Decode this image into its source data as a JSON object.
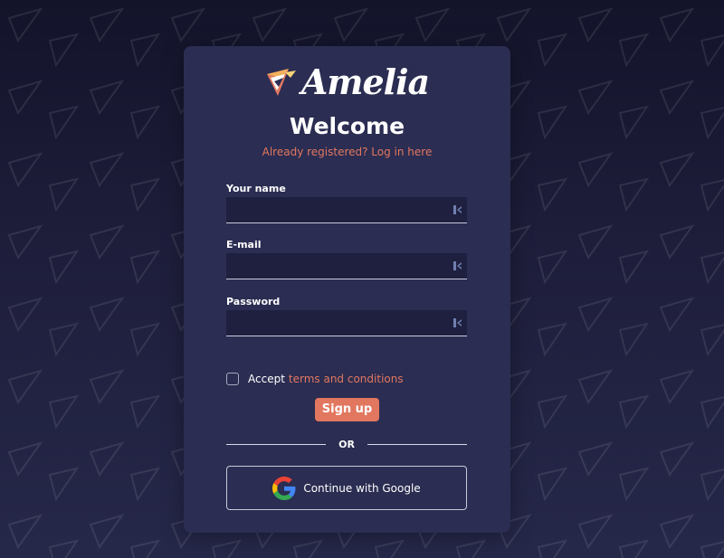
{
  "logo": {
    "text": "Amelia"
  },
  "welcome": {
    "title": "Welcome",
    "login_prompt": "Already registered? Log in here"
  },
  "fields": [
    {
      "label": "Your name",
      "value": "",
      "placeholder": ""
    },
    {
      "label": "E-mail",
      "value": "",
      "placeholder": ""
    },
    {
      "label": "Password",
      "value": "",
      "placeholder": ""
    }
  ],
  "terms": {
    "accept_text": "Accept",
    "link_text": "terms and conditions",
    "checked": false
  },
  "signup_button": {
    "label": "Sign up"
  },
  "divider": {
    "text": "OR"
  },
  "google_button": {
    "label": "Continue with Google"
  },
  "colors": {
    "accent": "#e2775f",
    "card": "#2b2d52",
    "input_bg": "#1f2040",
    "background": "#1d1d3a"
  },
  "icons": {
    "field_icon": "password-manager-icon",
    "google": "google-g-icon",
    "logo": "amelia-logo-icon"
  }
}
